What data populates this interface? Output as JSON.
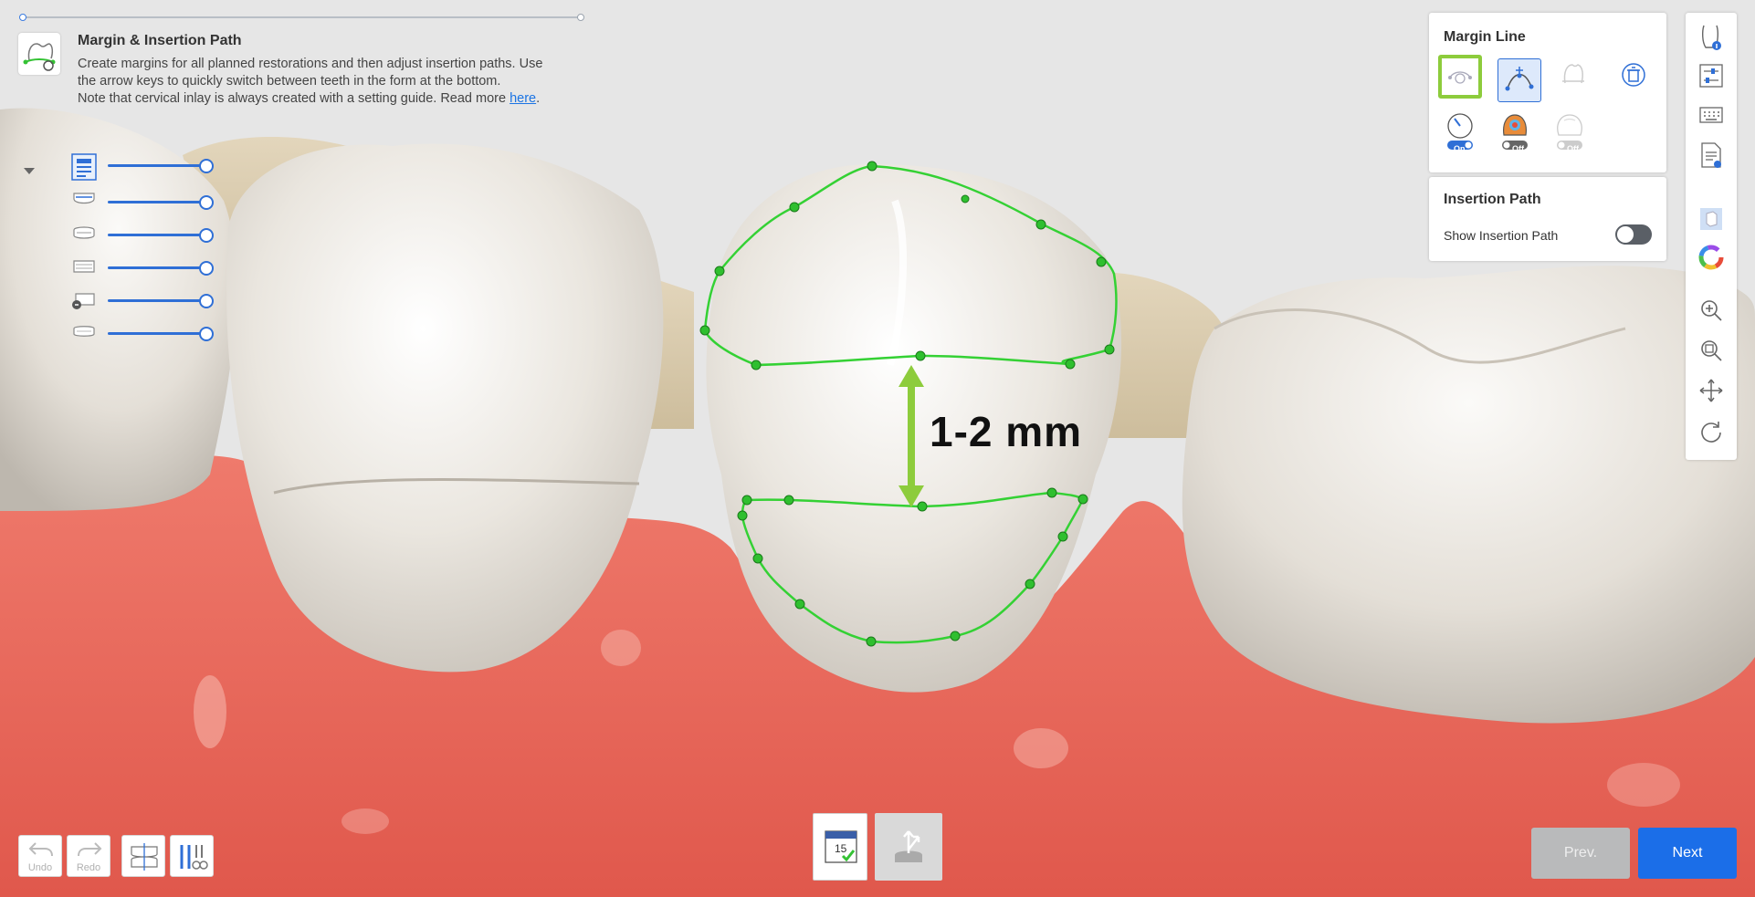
{
  "header": {
    "title": "Margin & Insertion Path",
    "description_line1": "Create margins for all planned restorations and then adjust insertion paths. Use",
    "description_line2": "the arrow keys to quickly switch between teeth in the form at the bottom.",
    "description_line3_prefix": "Note that cervical inlay is always created with a setting guide. Read more ",
    "description_link": "here",
    "description_line3_suffix": "."
  },
  "annotation": {
    "label": "1-2 mm"
  },
  "margin_line_panel": {
    "title": "Margin Line",
    "buttons": [
      {
        "icon": "auto-margin-icon",
        "state": "highlighted"
      },
      {
        "icon": "edit-margin-curve-icon",
        "state": "selected"
      },
      {
        "icon": "tooth-margin-icon",
        "state": "disabled"
      },
      {
        "icon": "delete-margin-icon",
        "state": "normal"
      }
    ],
    "toggles": [
      {
        "icon": "gauge-icon",
        "state_label": "On"
      },
      {
        "icon": "heatmap-icon",
        "state_label": "Off"
      },
      {
        "icon": "undercut-icon",
        "state_label": "Off"
      }
    ]
  },
  "insertion_path_panel": {
    "title": "Insertion Path",
    "show_label": "Show Insertion Path",
    "show_enabled": false
  },
  "bottom_toolbar": {
    "undo_label": "Undo",
    "redo_label": "Redo"
  },
  "center_tools": {
    "tooth_number": "15"
  },
  "navigation": {
    "prev_label": "Prev.",
    "next_label": "Next"
  },
  "colors": {
    "accent": "#2f6fd6",
    "margin_line": "#34d134",
    "highlight": "#8dcc3c",
    "next_button": "#1b6ee8",
    "prev_button": "#b9babb",
    "gum": "#e86b5e"
  }
}
